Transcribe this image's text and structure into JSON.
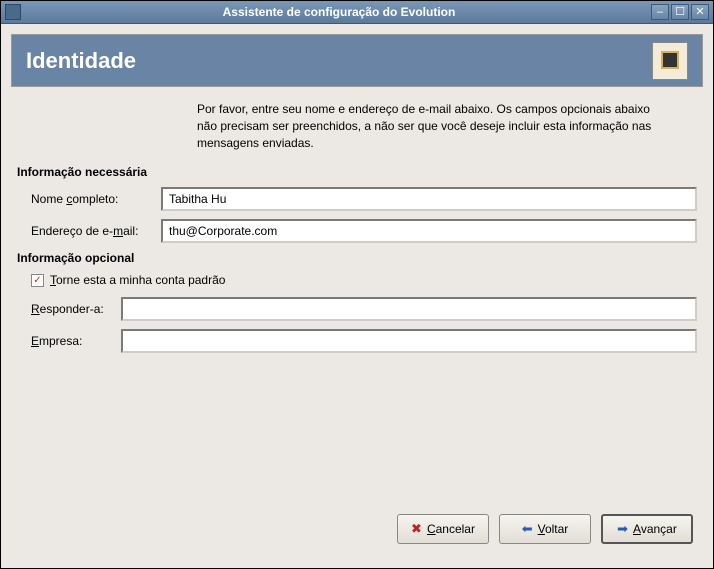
{
  "titlebar": {
    "title": "Assistente de configuração do Evolution"
  },
  "header": {
    "title": "Identidade"
  },
  "intro": "Por favor, entre seu nome e endereço de e-mail abaixo. Os campos opcionais abaixo não precisam ser preenchidos, a não ser que você deseje incluir esta informação nas mensagens enviadas.",
  "sections": {
    "required": "Informação necessária",
    "optional": "Informação opcional"
  },
  "fields": {
    "fullname_label_pre": "Nome ",
    "fullname_label_u": "c",
    "fullname_label_post": "ompleto:",
    "fullname_value": "Tabitha Hu",
    "email_label_pre": "Endereço de e-",
    "email_label_u": "m",
    "email_label_post": "ail:",
    "email_value": "thu@Corporate.com",
    "default_checkbox_u": "T",
    "default_checkbox_post": "orne esta a minha conta padrão",
    "default_checked": "✓",
    "replyto_label_u": "R",
    "replyto_label_post": "esponder-a:",
    "replyto_value": "",
    "org_label_u": "E",
    "org_label_post": "mpresa:",
    "org_value": ""
  },
  "buttons": {
    "cancel_u": "C",
    "cancel_post": "ancelar",
    "back_u": "V",
    "back_post": "oltar",
    "forward_u": "A",
    "forward_post": "vançar"
  }
}
